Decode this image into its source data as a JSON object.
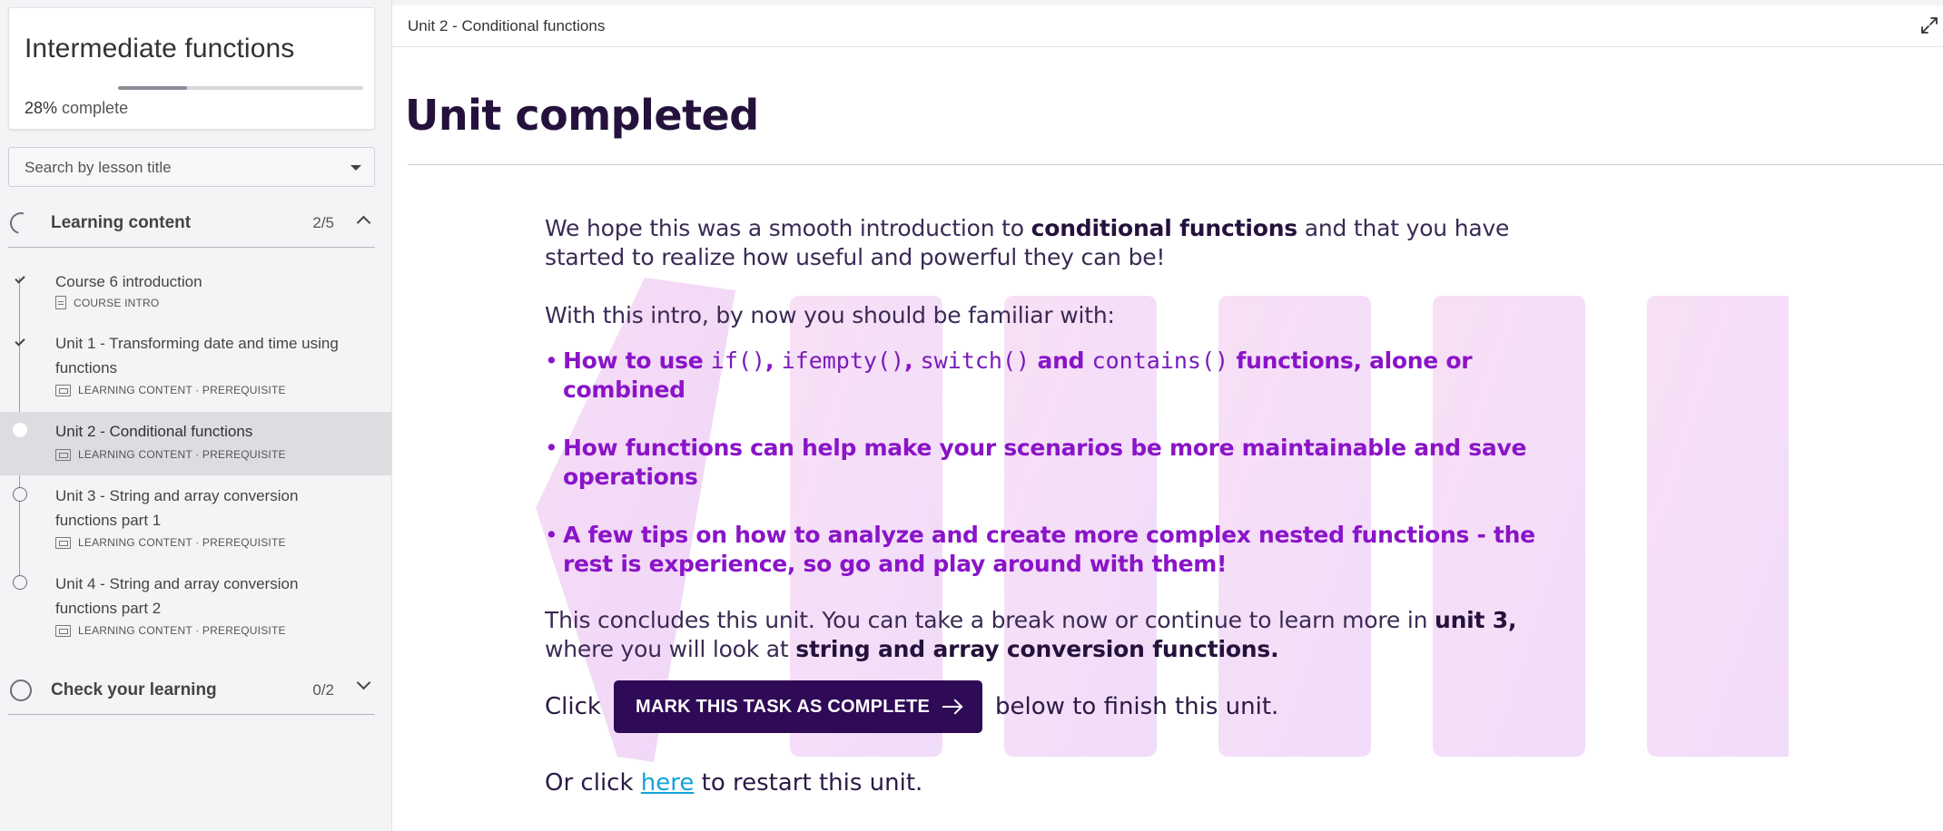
{
  "sidebar": {
    "course_title": "Intermediate functions",
    "progress": {
      "percent_label": "28%",
      "suffix": "complete",
      "fraction": 0.28
    },
    "search": {
      "placeholder": "Search by lesson title"
    },
    "sections": [
      {
        "label": "Learning content",
        "count": "2/5",
        "expanded": true,
        "lessons": [
          {
            "title": "Course 6 introduction",
            "meta": "COURSE INTRO",
            "status": "done",
            "icon": "document-icon"
          },
          {
            "title": "Unit 1 - Transforming date and time using functions",
            "meta": "LEARNING CONTENT · PREREQUISITE",
            "status": "done",
            "icon": "slides-icon"
          },
          {
            "title": "Unit 2 - Conditional functions",
            "meta": "LEARNING CONTENT · PREREQUISITE",
            "status": "current",
            "icon": "slides-icon"
          },
          {
            "title": "Unit 3 - String and array conversion functions part 1",
            "meta": "LEARNING CONTENT · PREREQUISITE",
            "status": "open",
            "icon": "slides-icon"
          },
          {
            "title": "Unit 4 - String and array conversion functions part 2",
            "meta": "LEARNING CONTENT · PREREQUISITE",
            "status": "open",
            "icon": "slides-icon"
          }
        ]
      },
      {
        "label": "Check your learning",
        "count": "0/2",
        "expanded": false
      }
    ]
  },
  "topbar": {
    "breadcrumb": "Unit 2 - Conditional functions",
    "expand_icon": "expand-icon"
  },
  "main": {
    "title": "Unit completed",
    "intro_1": "We hope this was a smooth introduction to ",
    "intro_bold": "conditional functions",
    "intro_2": " and that you have started to realize how useful and powerful they can be!",
    "familiar": "With this intro, by now you should be familiar with:",
    "bullet_1": {
      "a": "How to use ",
      "code_1": "if()",
      "sep_1": ", ",
      "code_2": "ifempty()",
      "sep_2": ", ",
      "code_3": "switch()",
      "and": " and ",
      "code_4": "contains()",
      "b": " functions, alone or combined"
    },
    "bullet_2": "How functions can help make your scenarios be more maintainable and save operations",
    "bullet_3": "A few tips on how to analyze and create more complex nested functions - the rest is experience, so go and play around with them!",
    "conclude_1": "This concludes this unit. You can take a break now or continue to learn more in ",
    "conclude_bold_1": "unit 3,",
    "conclude_2": " where you will look at ",
    "conclude_bold_2": "string and array conversion functions.",
    "click_label": "Click",
    "button_label": "MARK THIS TASK AS COMPLETE",
    "after_button": "below to finish this unit.",
    "restart_pre": "Or click ",
    "restart_link": "here",
    "restart_post": " to restart this unit."
  },
  "colors": {
    "accent_purple": "#8a14c8",
    "dark_purple": "#2f0a56",
    "link_blue": "#12a4d9",
    "title_color": "#24123c"
  }
}
